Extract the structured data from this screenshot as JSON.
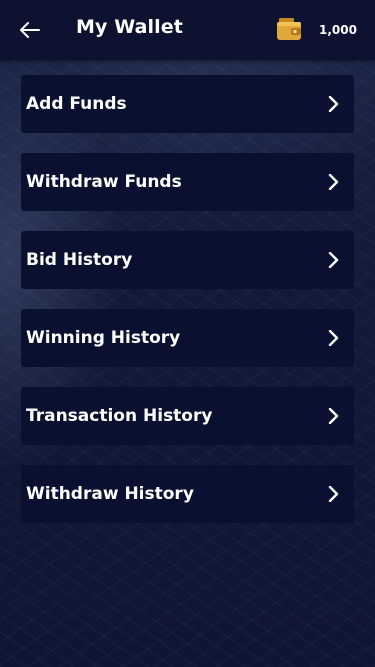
{
  "header": {
    "title": "My Wallet",
    "back_icon": "arrow-left-icon",
    "wallet_icon": "wallet-icon",
    "balance": "1,000"
  },
  "menu": {
    "items": [
      {
        "label": "Add Funds",
        "icon": "chevron-right-icon"
      },
      {
        "label": "Withdraw Funds",
        "icon": "chevron-right-icon"
      },
      {
        "label": "Bid History",
        "icon": "chevron-right-icon"
      },
      {
        "label": "Winning History",
        "icon": "chevron-right-icon"
      },
      {
        "label": "Transaction History",
        "icon": "chevron-right-icon"
      },
      {
        "label": "Withdraw History",
        "icon": "chevron-right-icon"
      }
    ]
  },
  "colors": {
    "background": "#12193a",
    "appbar": "#0c1230",
    "card": "#0a1030",
    "text": "#ffffff",
    "wallet_gold": "#e0a83a"
  }
}
